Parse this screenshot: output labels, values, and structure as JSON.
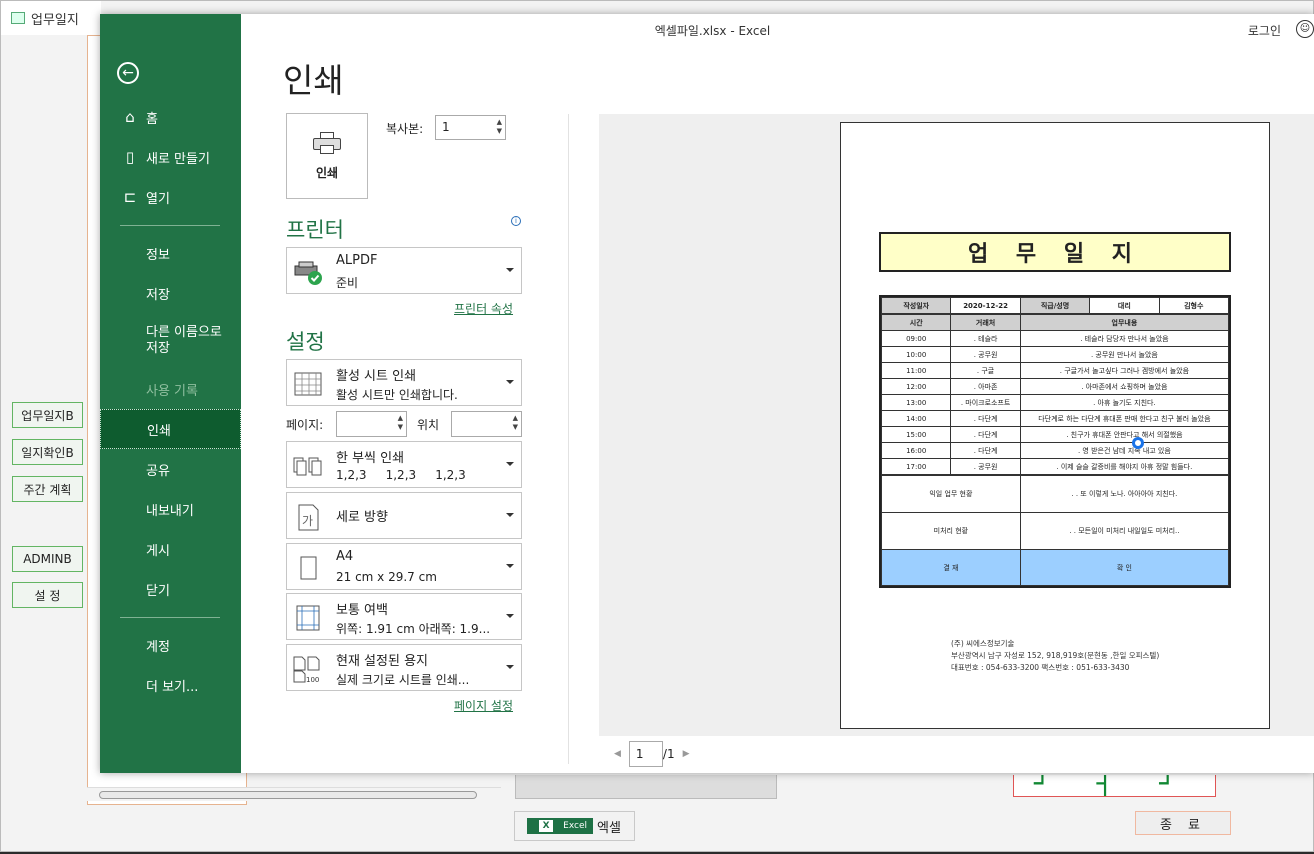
{
  "host": {
    "title": "업무일지",
    "side_buttons": [
      "업무일지B",
      "일지확인B",
      "주간 계획",
      "ADMINB",
      "설   정"
    ],
    "bottom_label": "엑셀",
    "excel_logo_text": "Excel",
    "end_button": "종 료"
  },
  "excel": {
    "window_title": "엑셀파일.xlsx  -  Excel",
    "login": "로그인"
  },
  "nav": {
    "back": "←",
    "items": [
      {
        "label": "홈",
        "icon": "home-icon"
      },
      {
        "label": "새로 만들기",
        "icon": "new-doc-icon"
      },
      {
        "label": "열기",
        "icon": "folder-open-icon"
      },
      {
        "label": "정보"
      },
      {
        "label": "저장"
      },
      {
        "label": "다른 이름으로 저장"
      },
      {
        "label": "사용 기록"
      },
      {
        "label": "인쇄"
      },
      {
        "label": "공유"
      },
      {
        "label": "내보내기"
      },
      {
        "label": "게시"
      },
      {
        "label": "닫기"
      },
      {
        "label": "계정"
      },
      {
        "label": "더 보기..."
      }
    ]
  },
  "print": {
    "title": "인쇄",
    "print_button": "인쇄",
    "copies_label": "복사본:",
    "copies_value": "1",
    "printer_heading": "프린터",
    "printer_name": "ALPDF",
    "printer_status": "준비",
    "printer_props_link": "프린터 속성",
    "settings_heading": "설정",
    "scope_l1": "활성 시트 인쇄",
    "scope_l2": "활성 시트만 인쇄합니다.",
    "pages_label": "페이지:",
    "position_label": "위치",
    "collate_l1": "한 부씩 인쇄",
    "collate_l2": "1,2,3     1,2,3     1,2,3",
    "orientation": "세로 방향",
    "paper_l1": "A4",
    "paper_l2": "21 cm x 29.7 cm",
    "margins_l1": "보통 여백",
    "margins_l2": "위쪽: 1.91 cm 아래쪽: 1.9...",
    "scaling_l1": "현재 설정된 용지",
    "scaling_l2": "실제 크기로 시트를 인쇄...",
    "page_setup_link": "페이지 설정",
    "orientation_icon_char": "가",
    "scaling_icon_text": "100"
  },
  "preview": {
    "doc_title": "업 무 일 지",
    "info": [
      "작성일자",
      "2020-12-22",
      "직급/성명",
      "대리",
      "김형수"
    ],
    "header": [
      "시간",
      "거래처",
      "업무내용"
    ],
    "rows": [
      [
        "09:00",
        ". 테슬라",
        ". 테슬라 담당자 만나서 놀았음"
      ],
      [
        "10:00",
        ". 공무원",
        ". 공무원 만나서 놀았음"
      ],
      [
        "11:00",
        ". 구글",
        ". 구글가서 놀고싶다 그러나 겜방에서 놀았음"
      ],
      [
        "12:00",
        ". 아마존",
        ". 아마존에서 쇼핑하며 놀았음"
      ],
      [
        "13:00",
        ". 마이크로소프트",
        ". 아휴 놀기도 지친다."
      ],
      [
        "14:00",
        ". 다단계",
        "다단계로 하는 다단계 휴대폰 판매 한다고 친구 불러 놀았음"
      ],
      [
        "15:00",
        ". 다단계",
        ". 친구가 휴대폰 안판다고 해서 의절했음"
      ],
      [
        "16:00",
        ". 다단계",
        ". 영 받은건 남데 지속 내고 있음"
      ],
      [
        "17:00",
        ". 공무원",
        ". 이제 슬슬 갈증비를 해야지 아휴 정말 힘들다."
      ]
    ],
    "next_day_label": "익일 업무 현황",
    "next_day_value": ". . 또 이렇게 노나. 아아아아 지친다.",
    "pending_label": "미처리 현황",
    "pending_value": ". . 모든일이 미처리 내일일도 미처리..",
    "approve_left": "결 재",
    "approve_right": "확 인",
    "footer": [
      "(주) 씨에스정보기술",
      "부산광역시 남구 자성로 152, 918,919호(문현동 ,한일 오피스텔)",
      "대표번호 : 054-633-3200   팩스번호 : 051-633-3430"
    ],
    "page_current": "1",
    "page_total": "/1"
  }
}
